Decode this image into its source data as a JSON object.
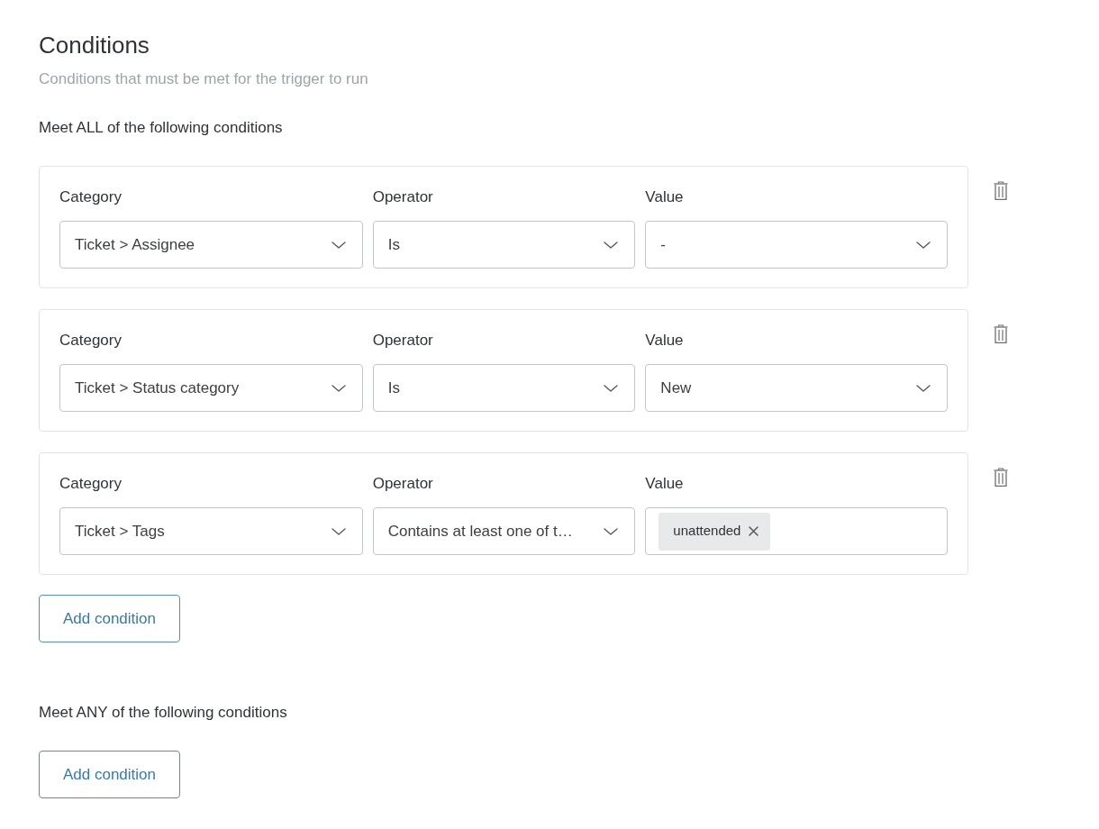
{
  "section": {
    "title": "Conditions",
    "description": "Conditions that must be met for the trigger to run"
  },
  "groups": [
    {
      "heading": "Meet ALL of the following conditions",
      "conditions": [
        {
          "fields": [
            {
              "kind": "select",
              "label": "Category",
              "value": "Ticket > Assignee"
            },
            {
              "kind": "select",
              "label": "Operator",
              "value": "Is"
            },
            {
              "kind": "select",
              "label": "Value",
              "value": "-"
            }
          ]
        },
        {
          "fields": [
            {
              "kind": "select",
              "label": "Category",
              "value": "Ticket > Status category"
            },
            {
              "kind": "select",
              "label": "Operator",
              "value": "Is"
            },
            {
              "kind": "select",
              "label": "Value",
              "value": "New"
            }
          ]
        },
        {
          "fields": [
            {
              "kind": "select",
              "label": "Category",
              "value": "Ticket > Tags"
            },
            {
              "kind": "select",
              "label": "Operator",
              "value": "Contains at least one of t…"
            },
            {
              "kind": "tags",
              "label": "Value",
              "tags": [
                "unattended"
              ]
            }
          ]
        }
      ],
      "add_button": "Add condition"
    },
    {
      "heading": "Meet ANY of the following conditions",
      "add_button": "Add condition"
    }
  ]
}
